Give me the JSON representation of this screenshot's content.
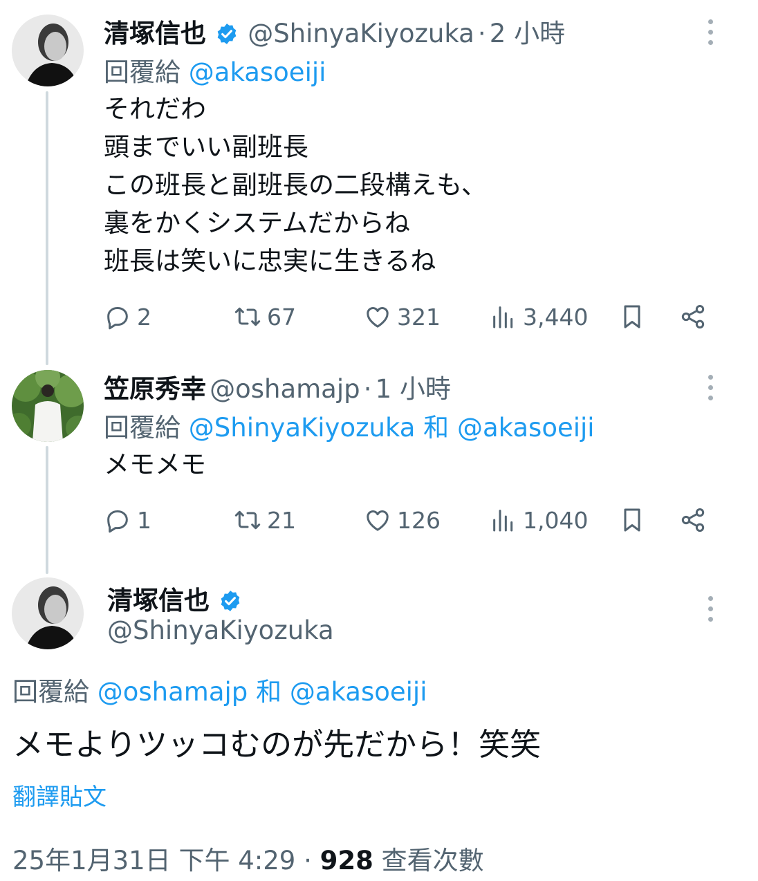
{
  "tweets": [
    {
      "author_name": "清塚信也",
      "handle": "@ShinyaKiyozuka",
      "separator": "·",
      "time": "2 小時",
      "reply_prefix": "回覆給",
      "reply_to": [
        "@akasoeiji"
      ],
      "lines": [
        "それだわ",
        "頭までいい副班長",
        "この班長と副班長の二段構えも、",
        "裏をかくシステムだからね",
        "班長は笑いに忠実に生きるね"
      ],
      "stats": {
        "replies": "2",
        "reposts": "67",
        "likes": "321",
        "views": "3,440"
      }
    },
    {
      "author_name": "笠原秀幸",
      "handle": "@oshamajp",
      "separator": "·",
      "time": "1 小時",
      "reply_prefix": "回覆給",
      "reply_to": [
        "@ShinyaKiyozuka",
        "@akasoeiji"
      ],
      "reply_joiner": "和",
      "lines": [
        "メモメモ"
      ],
      "stats": {
        "replies": "1",
        "reposts": "21",
        "likes": "126",
        "views": "1,040"
      }
    },
    {
      "author_name": "清塚信也",
      "handle": "@ShinyaKiyozuka",
      "reply_prefix": "回覆給",
      "reply_to": [
        "@oshamajp",
        "@akasoeiji"
      ],
      "reply_joiner": "和",
      "text": "メモよりツッコむのが先だから！笑笑",
      "translate": "翻譯貼文",
      "date": "25年1月31日 下午 4:29",
      "dot": "·",
      "views_count": "928",
      "views_label": "查看次數"
    }
  ],
  "colors": {
    "link": "#1d9bf0",
    "muted": "#536471",
    "verified": "#1d9bf0",
    "thread_line": "#cfd9de"
  }
}
